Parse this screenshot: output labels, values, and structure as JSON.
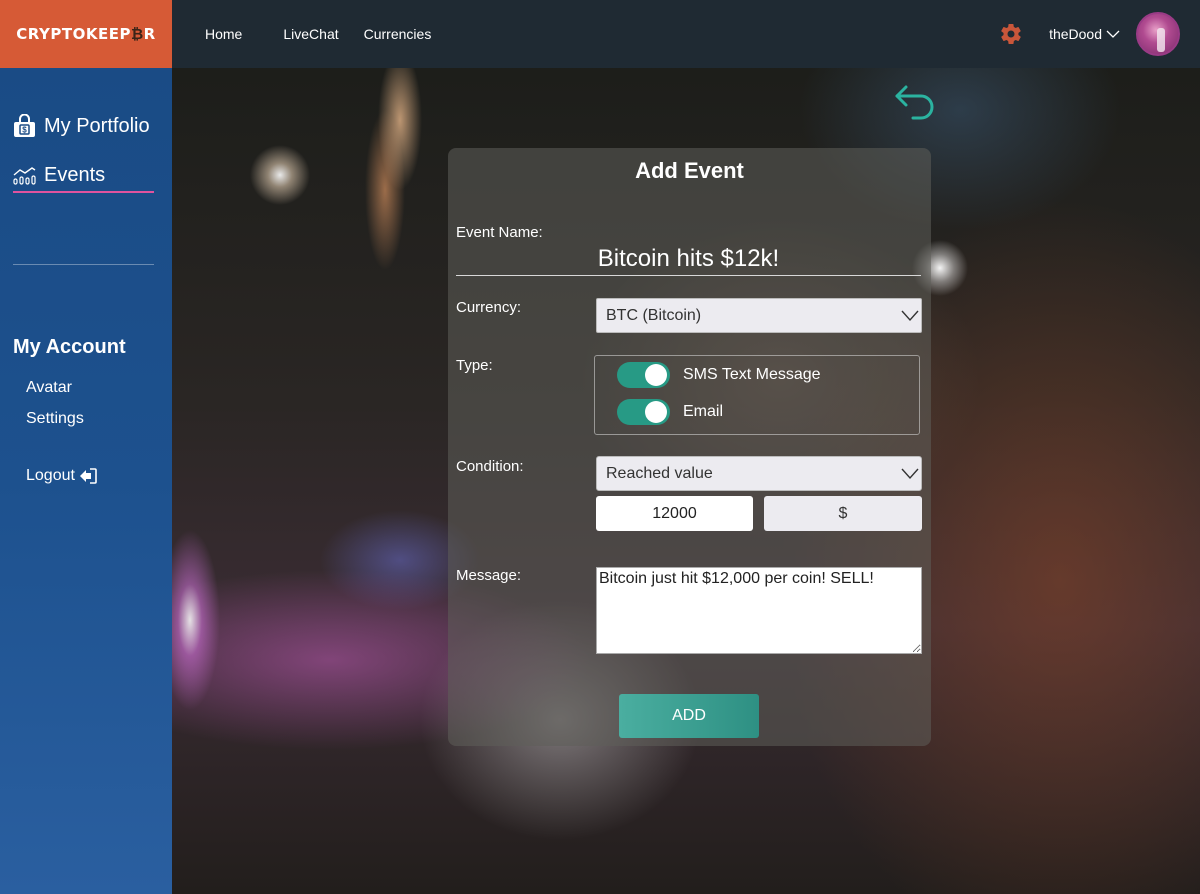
{
  "header": {
    "brand_prefix": "CRYPTOKEEP",
    "brand_coin": "₿",
    "brand_suffix": "R",
    "nav": [
      {
        "label": "Home"
      },
      {
        "label": "LiveChat"
      },
      {
        "label": "Currencies"
      }
    ],
    "username": "theDood",
    "gear_icon": "gear-icon",
    "avatar_icon": "user-avatar"
  },
  "sidebar": {
    "items": [
      {
        "label": "My Portfolio",
        "icon": "portfolio-bag-icon",
        "active": false
      },
      {
        "label": "Events",
        "icon": "chart-events-icon",
        "active": true
      }
    ],
    "account_title": "My Account",
    "account_links": [
      {
        "label": "Avatar"
      },
      {
        "label": "Settings"
      }
    ],
    "logout_label": "Logout",
    "logout_icon": "logout-icon"
  },
  "form": {
    "title": "Add Event",
    "event_name_label": "Event Name:",
    "event_name_value": "Bitcoin hits $12k!",
    "currency_label": "Currency:",
    "currency_value": "BTC (Bitcoin)",
    "type_label": "Type:",
    "types": [
      {
        "label": "SMS Text Message",
        "enabled": true
      },
      {
        "label": "Email",
        "enabled": true
      }
    ],
    "condition_label": "Condition:",
    "condition_value": "Reached value",
    "threshold_value": "12000",
    "unit_value": "$",
    "message_label": "Message:",
    "message_value": "Bitcoin just hit $12,000 per coin! SELL!",
    "add_label": "ADD"
  },
  "colors": {
    "brand": "#d65a36",
    "topbar": "#1f2a33",
    "sidebar": "#1a4b85",
    "accent_teal": "#279a85",
    "active_underline": "#e0539e"
  }
}
